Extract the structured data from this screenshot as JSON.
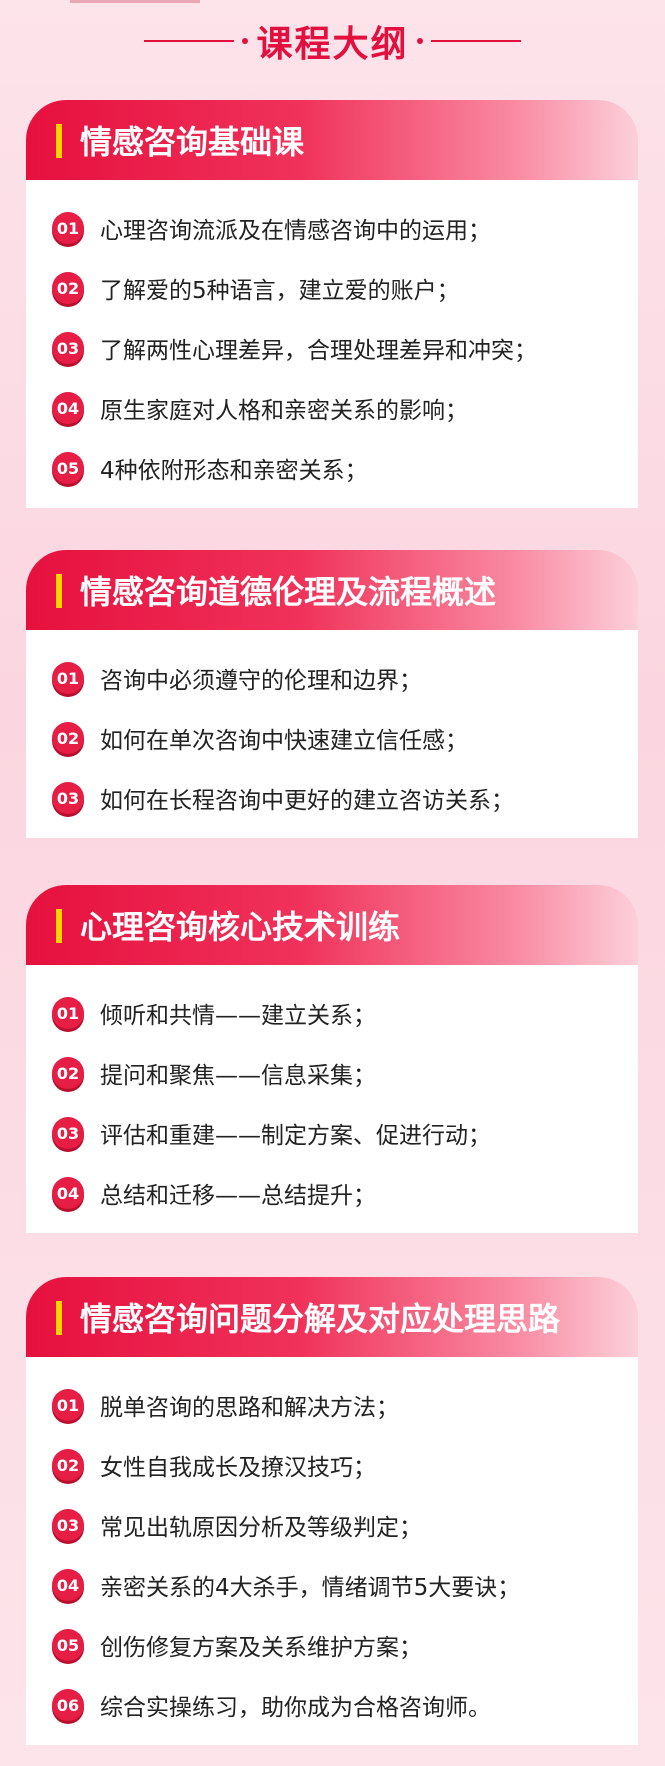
{
  "header": {
    "title": "课程大纲"
  },
  "sections": [
    {
      "title": "情感咨询基础课",
      "items": [
        {
          "num": "01",
          "text": "心理咨询流派及在情感咨询中的运用；"
        },
        {
          "num": "02",
          "text": "了解爱的5种语言，建立爱的账户；"
        },
        {
          "num": "03",
          "text": "了解两性心理差异，合理处理差异和冲突；"
        },
        {
          "num": "04",
          "text": "原生家庭对人格和亲密关系的影响；"
        },
        {
          "num": "05",
          "text": "4种依附形态和亲密关系；"
        }
      ]
    },
    {
      "title": "情感咨询道德伦理及流程概述",
      "items": [
        {
          "num": "01",
          "text": "咨询中必须遵守的伦理和边界；"
        },
        {
          "num": "02",
          "text": "如何在单次咨询中快速建立信任感；"
        },
        {
          "num": "03",
          "text": "如何在长程咨询中更好的建立咨访关系；"
        }
      ]
    },
    {
      "title": "心理咨询核心技术训练",
      "items": [
        {
          "num": "01",
          "text": "倾听和共情——建立关系；"
        },
        {
          "num": "02",
          "text": "提问和聚焦——信息采集；"
        },
        {
          "num": "03",
          "text": "评估和重建——制定方案、促进行动；"
        },
        {
          "num": "04",
          "text": "总结和迁移——总结提升；"
        }
      ]
    },
    {
      "title": "情感咨询问题分解及对应处理思路",
      "items": [
        {
          "num": "01",
          "text": "脱单咨询的思路和解决方法；"
        },
        {
          "num": "02",
          "text": "女性自我成长及撩汉技巧；"
        },
        {
          "num": "03",
          "text": "常见出轨原因分析及等级判定；"
        },
        {
          "num": "04",
          "text": "亲密关系的4大杀手，情绪调节5大要诀；"
        },
        {
          "num": "05",
          "text": "创伤修复方案及关系维护方案；"
        },
        {
          "num": "06",
          "text": "综合实操练习，助你成为合格咨询师。"
        }
      ]
    }
  ]
}
